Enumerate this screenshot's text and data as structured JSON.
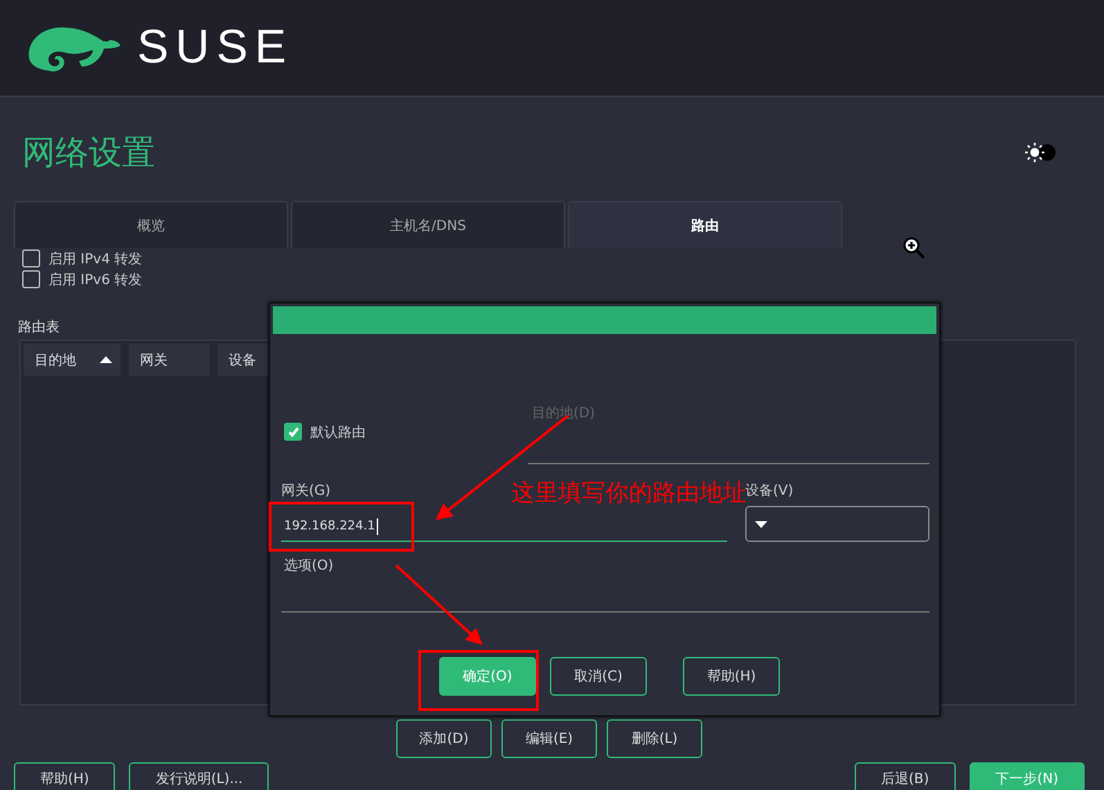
{
  "header": {
    "brand": "SUSE"
  },
  "page": {
    "title": "网络设置"
  },
  "tabs": [
    {
      "label": "概览",
      "selected": false
    },
    {
      "label": "主机名/DNS",
      "selected": false
    },
    {
      "label": "路由",
      "selected": true
    }
  ],
  "forwarding": [
    {
      "label": "启用 IPv4 转发",
      "checked": false
    },
    {
      "label": "启用 IPv6 转发",
      "checked": false
    }
  ],
  "routing_table": {
    "label": "路由表",
    "columns": [
      {
        "label": "目的地",
        "sorted": true
      },
      {
        "label": "网关",
        "sorted": false
      },
      {
        "label": "设备"
      }
    ],
    "buttons": [
      "添加(D)",
      "编辑(E)",
      "删除(L)"
    ]
  },
  "dialog": {
    "destination": {
      "label": "目的地(D)",
      "disabled": true
    },
    "default_route": {
      "label": "默认路由",
      "checked": true
    },
    "gateway": {
      "label": "网关(G)",
      "value": "192.168.224.1"
    },
    "device": {
      "label": "设备(V)"
    },
    "options": {
      "label": "选项(O)"
    },
    "buttons": [
      {
        "label": "确定(O)",
        "kind": "primary"
      },
      {
        "label": "取消(C)",
        "kind": "secondary"
      },
      {
        "label": "帮助(H)",
        "kind": "secondary"
      }
    ]
  },
  "annotation": {
    "text": "这里填写你的路由地址"
  },
  "footer": {
    "left_buttons": [
      "帮助(H)",
      "发行说明(L)..."
    ],
    "right_buttons": [
      {
        "label": "后退(B)",
        "kind": "secondary"
      },
      {
        "label": "下一步(N)",
        "kind": "primary"
      }
    ]
  }
}
